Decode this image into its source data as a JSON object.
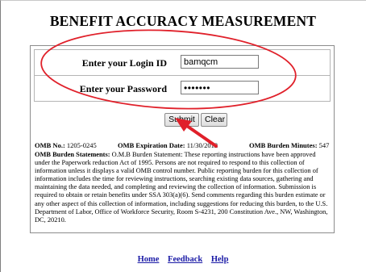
{
  "page": {
    "title": "BENEFIT ACCURACY MEASUREMENT"
  },
  "login": {
    "login_label": "Enter your Login ID",
    "login_value": "bamqcm",
    "password_label": "Enter your Password",
    "password_value": "•••••••",
    "submit_label": "Submit",
    "clear_label": "Clear"
  },
  "omb": {
    "no_label": "OMB No.:",
    "no_value": "1205-0245",
    "expiration_label": "OMB Expiration Date:",
    "expiration_value": "11/30/2012",
    "burden_minutes_label": "OMB Burden Minutes:",
    "burden_minutes_value": "547",
    "statements_label": "OMB Burden Statements:",
    "statements_text": "O.M.B Burden Statement: These reporting instructions have been approved under the Paperwork reduction Act of 1995. Persons are not required to respond to this collection of information unless it displays a valid OMB control number. Public reporting burden for this collection of information includes the time for reviewing instructions, searching existing data sources, gathering and maintaining the data needed, and completing and reviewing the collection of information. Submission is required to obtain or retain benefits under SSA 303(a)(6). Send comments regarding this burden estimate or any other aspect of this collection of information, including suggestions for reducing this burden, to the U.S. Department of Labor, Office of Workforce Security, Room S-4231, 200 Constitution Ave., NW, Washington, DC, 20210."
  },
  "footer": {
    "links": [
      "Home",
      "Feedback",
      "Help"
    ]
  },
  "annotations": {
    "ellipse_color": "#e0202a",
    "arrow_color": "#e0202a"
  }
}
